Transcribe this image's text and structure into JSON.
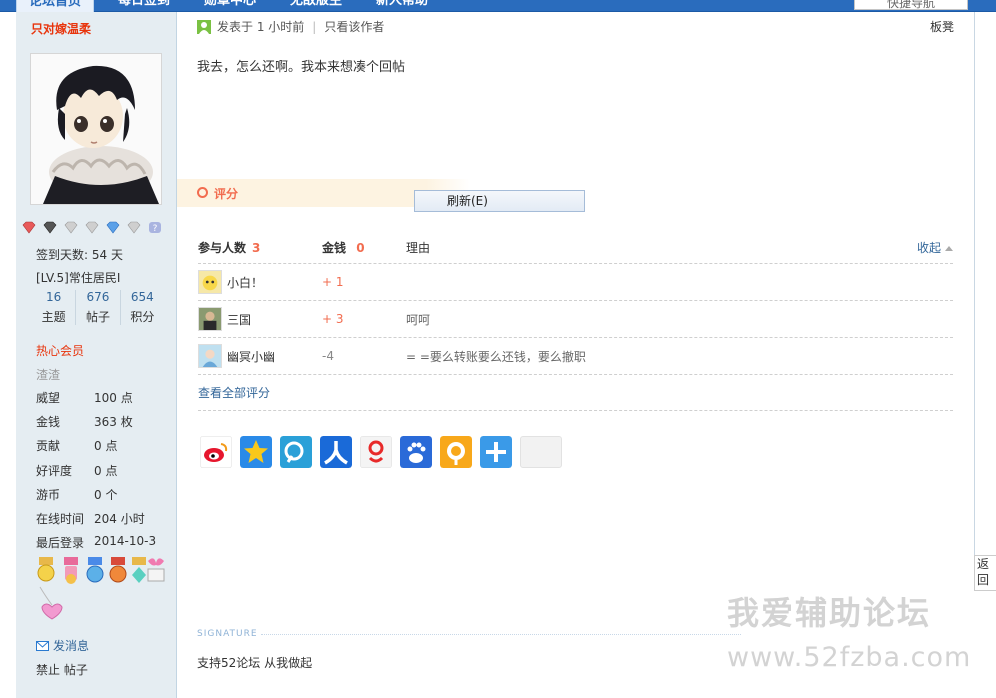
{
  "nav": {
    "tabs": [
      "论坛首页",
      "每日签到",
      "勋章中心",
      "无敌版主",
      "新人帮助"
    ],
    "quick_nav": "快捷导航"
  },
  "sidebar": {
    "username": "只对嫁温柔",
    "signin_days": "签到天数: 54 天",
    "level": "[LV.5]常住居民I",
    "stats": [
      {
        "num": "16",
        "label": "主题"
      },
      {
        "num": "676",
        "label": "帖子"
      },
      {
        "num": "654",
        "label": "积分"
      }
    ],
    "group": "热心会员",
    "group_sub": "渣渣",
    "info": [
      {
        "k": "威望",
        "v": "100 点"
      },
      {
        "k": "金钱",
        "v": "363 枚"
      },
      {
        "k": "贡献",
        "v": "0 点"
      },
      {
        "k": "好评度",
        "v": "0 点"
      },
      {
        "k": "游币",
        "v": "0 个"
      },
      {
        "k": "在线时间",
        "v": "204 小时"
      },
      {
        "k": "最后登录",
        "v": "2014-10-3"
      }
    ],
    "send_message": "发消息",
    "ban": "禁止 帖子"
  },
  "post": {
    "posted": "发表于 1 小时前",
    "only_author": "只看该作者",
    "floor": "板凳",
    "content": "我去，怎么还啊。我本来想凑个回帖"
  },
  "rating": {
    "label": "评分",
    "context_menu": "刷新(E)",
    "head_participants": "参与人数",
    "participants": "3",
    "head_gold": "金钱",
    "gold_total": "0",
    "head_reason": "理由",
    "collapse": "收起",
    "rows": [
      {
        "user": "小白！",
        "gold": "+ 1",
        "reason": ""
      },
      {
        "user": "三国",
        "gold": "+ 3",
        "reason": "呵呵"
      },
      {
        "user": "幽冥小幽",
        "gold": "-4",
        "reason": "= =要么转账要么还钱，要么撤职"
      }
    ],
    "view_all": "查看全部评分"
  },
  "signature": {
    "label": "SIGNATURE",
    "text": "支持52论坛  从我做起"
  },
  "watermark": {
    "line1": "我爱辅助论坛",
    "line2": "www.52fzba.com"
  },
  "back_top": "返回顶部",
  "colors": {
    "sidebar_bg": "#e5edf2",
    "accent_red": "#e8340c",
    "link_blue": "#336699",
    "rate_orange": "#f26c4f"
  }
}
